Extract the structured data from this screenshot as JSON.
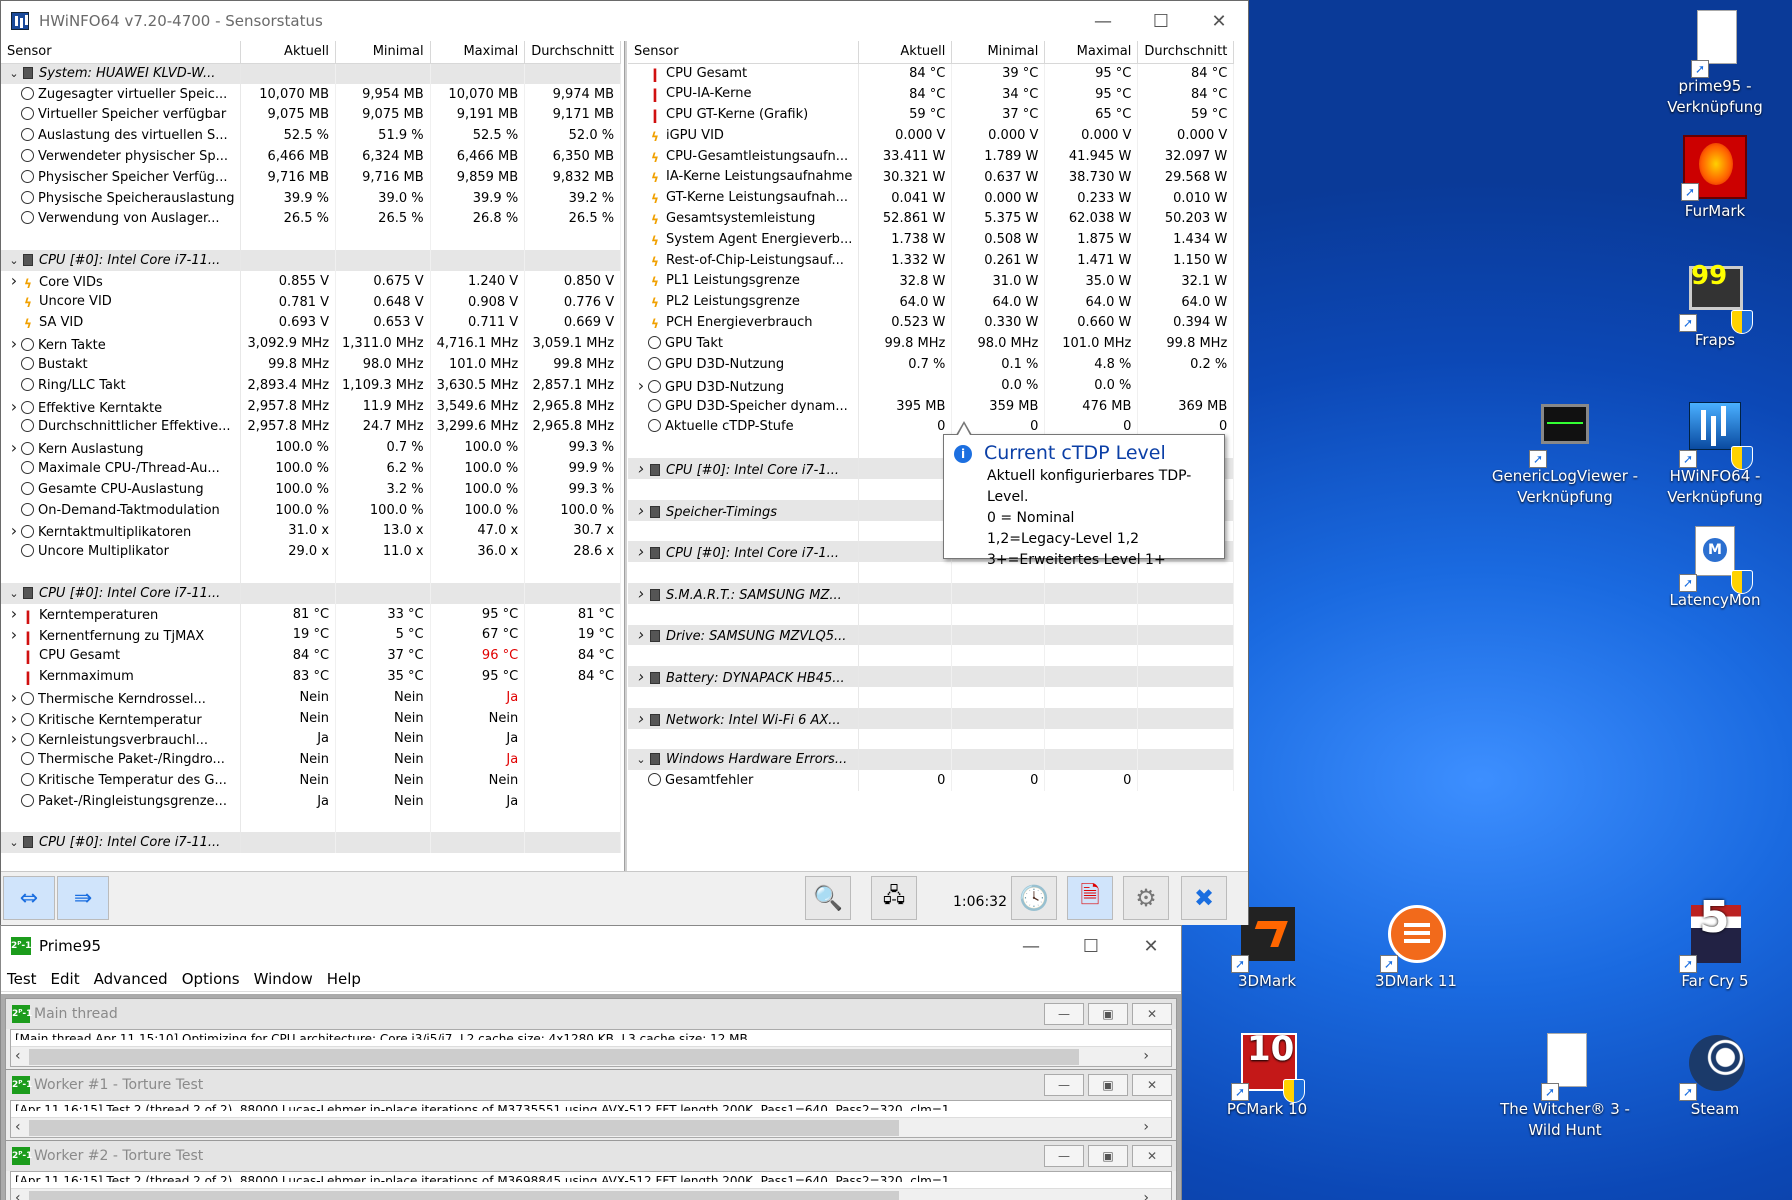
{
  "hwinfo": {
    "title": "HWiNFO64 v7.20-4700 - Sensorstatus",
    "left": {
      "headers": [
        "Sensor",
        "Aktuell",
        "Minimal",
        "Maximal",
        "Durchschnitt"
      ],
      "rows": [
        {
          "type": "group",
          "expand": "down",
          "label": "System: HUAWEI KLVD-W..."
        },
        {
          "type": "row",
          "icon": "clock",
          "label": "Zugesagter virtueller Speic...",
          "v": [
            "10,070 MB",
            "9,954 MB",
            "10,070 MB",
            "9,974 MB"
          ]
        },
        {
          "type": "row",
          "icon": "clock",
          "label": "Virtueller Speicher verfügbar",
          "v": [
            "9,075 MB",
            "9,075 MB",
            "9,191 MB",
            "9,171 MB"
          ]
        },
        {
          "type": "row",
          "icon": "clock",
          "label": "Auslastung des virtuellen S...",
          "v": [
            "52.5 %",
            "51.9 %",
            "52.5 %",
            "52.0 %"
          ]
        },
        {
          "type": "row",
          "icon": "clock",
          "label": "Verwendeter physischer Sp...",
          "v": [
            "6,466 MB",
            "6,324 MB",
            "6,466 MB",
            "6,350 MB"
          ]
        },
        {
          "type": "row",
          "icon": "clock",
          "label": "Physischer Speicher Verfüg...",
          "v": [
            "9,716 MB",
            "9,716 MB",
            "9,859 MB",
            "9,832 MB"
          ]
        },
        {
          "type": "row",
          "icon": "clock",
          "label": "Physische Speicherauslastung",
          "v": [
            "39.9 %",
            "39.0 %",
            "39.9 %",
            "39.2 %"
          ]
        },
        {
          "type": "row",
          "icon": "clock",
          "label": "Verwendung von Auslager...",
          "v": [
            "26.5 %",
            "26.5 %",
            "26.8 %",
            "26.5 %"
          ]
        },
        {
          "type": "blank"
        },
        {
          "type": "group",
          "expand": "down",
          "label": "CPU [#0]: Intel Core i7-11..."
        },
        {
          "type": "row",
          "expand": "right",
          "icon": "volt",
          "label": "Core VIDs",
          "v": [
            "0.855 V",
            "0.675 V",
            "1.240 V",
            "0.850 V"
          ]
        },
        {
          "type": "row",
          "icon": "volt",
          "label": "Uncore VID",
          "v": [
            "0.781 V",
            "0.648 V",
            "0.908 V",
            "0.776 V"
          ]
        },
        {
          "type": "row",
          "icon": "volt",
          "label": "SA VID",
          "v": [
            "0.693 V",
            "0.653 V",
            "0.711 V",
            "0.669 V"
          ]
        },
        {
          "type": "row",
          "expand": "right",
          "icon": "clock",
          "label": "Kern Takte",
          "v": [
            "3,092.9 MHz",
            "1,311.0 MHz",
            "4,716.1 MHz",
            "3,059.1 MHz"
          ]
        },
        {
          "type": "row",
          "icon": "clock",
          "label": "Bustakt",
          "v": [
            "99.8 MHz",
            "98.0 MHz",
            "101.0 MHz",
            "99.8 MHz"
          ]
        },
        {
          "type": "row",
          "icon": "clock",
          "label": "Ring/LLC Takt",
          "v": [
            "2,893.4 MHz",
            "1,109.3 MHz",
            "3,630.5 MHz",
            "2,857.1 MHz"
          ]
        },
        {
          "type": "row",
          "expand": "right",
          "icon": "clock",
          "label": "Effektive Kerntakte",
          "v": [
            "2,957.8 MHz",
            "11.9 MHz",
            "3,549.6 MHz",
            "2,965.8 MHz"
          ]
        },
        {
          "type": "row",
          "icon": "clock",
          "label": "Durchschnittlicher Effektive...",
          "v": [
            "2,957.8 MHz",
            "24.7 MHz",
            "3,299.6 MHz",
            "2,965.8 MHz"
          ]
        },
        {
          "type": "row",
          "expand": "right",
          "icon": "clock",
          "label": "Kern Auslastung",
          "v": [
            "100.0 %",
            "0.7 %",
            "100.0 %",
            "99.3 %"
          ]
        },
        {
          "type": "row",
          "icon": "clock",
          "label": "Maximale CPU-/Thread-Au...",
          "v": [
            "100.0 %",
            "6.2 %",
            "100.0 %",
            "99.9 %"
          ]
        },
        {
          "type": "row",
          "icon": "clock",
          "label": "Gesamte CPU-Auslastung",
          "v": [
            "100.0 %",
            "3.2 %",
            "100.0 %",
            "99.3 %"
          ]
        },
        {
          "type": "row",
          "icon": "clock",
          "label": "On-Demand-Taktmodulation",
          "v": [
            "100.0 %",
            "100.0 %",
            "100.0 %",
            "100.0 %"
          ]
        },
        {
          "type": "row",
          "expand": "right",
          "icon": "clock",
          "label": "Kerntaktmultiplikatoren",
          "v": [
            "31.0 x",
            "13.0 x",
            "47.0 x",
            "30.7 x"
          ]
        },
        {
          "type": "row",
          "icon": "clock",
          "label": "Uncore Multiplikator",
          "v": [
            "29.0 x",
            "11.0 x",
            "36.0 x",
            "28.6 x"
          ]
        },
        {
          "type": "blank"
        },
        {
          "type": "group",
          "expand": "down",
          "label": "CPU [#0]: Intel Core i7-11..."
        },
        {
          "type": "row",
          "expand": "right",
          "icon": "therm",
          "label": "Kerntemperaturen",
          "v": [
            "81 °C",
            "33 °C",
            "95 °C",
            "81 °C"
          ]
        },
        {
          "type": "row",
          "expand": "right",
          "icon": "therm",
          "label": "Kernentfernung zu TjMAX",
          "v": [
            "19 °C",
            "5 °C",
            "67 °C",
            "19 °C"
          ]
        },
        {
          "type": "row",
          "icon": "therm",
          "label": "CPU Gesamt",
          "v": [
            "84 °C",
            "37 °C",
            "96 °C",
            "84 °C"
          ],
          "red": [
            2
          ]
        },
        {
          "type": "row",
          "icon": "therm",
          "label": "Kernmaximum",
          "v": [
            "83 °C",
            "35 °C",
            "95 °C",
            "84 °C"
          ]
        },
        {
          "type": "row",
          "expand": "right",
          "icon": "clock",
          "label": "Thermische Kerndrossel...",
          "v": [
            "Nein",
            "Nein",
            "Ja",
            ""
          ],
          "red": [
            2
          ]
        },
        {
          "type": "row",
          "expand": "right",
          "icon": "clock",
          "label": "Kritische Kerntemperatur",
          "v": [
            "Nein",
            "Nein",
            "Nein",
            ""
          ]
        },
        {
          "type": "row",
          "expand": "right",
          "icon": "clock",
          "label": "Kernleistungsverbrauchl...",
          "v": [
            "Ja",
            "Nein",
            "Ja",
            ""
          ]
        },
        {
          "type": "row",
          "icon": "clock",
          "label": "Thermische Paket-/Ringdro...",
          "v": [
            "Nein",
            "Nein",
            "Ja",
            ""
          ],
          "red": [
            2
          ]
        },
        {
          "type": "row",
          "icon": "clock",
          "label": "Kritische Temperatur des G...",
          "v": [
            "Nein",
            "Nein",
            "Nein",
            ""
          ]
        },
        {
          "type": "row",
          "icon": "clock",
          "label": "Paket-/Ringleistungsgrenze...",
          "v": [
            "Ja",
            "Nein",
            "Ja",
            ""
          ]
        },
        {
          "type": "blank"
        },
        {
          "type": "group",
          "expand": "down",
          "label": "CPU [#0]: Intel Core i7-11..."
        }
      ]
    },
    "right": {
      "headers": [
        "Sensor",
        "Aktuell",
        "Minimal",
        "Maximal",
        "Durchschnitt"
      ],
      "rows": [
        {
          "type": "row",
          "icon": "therm",
          "label": "CPU Gesamt",
          "v": [
            "84 °C",
            "39 °C",
            "95 °C",
            "84 °C"
          ]
        },
        {
          "type": "row",
          "icon": "therm",
          "label": "CPU-IA-Kerne",
          "v": [
            "84 °C",
            "34 °C",
            "95 °C",
            "84 °C"
          ]
        },
        {
          "type": "row",
          "icon": "therm",
          "label": "CPU GT-Kerne (Grafik)",
          "v": [
            "59 °C",
            "37 °C",
            "65 °C",
            "59 °C"
          ]
        },
        {
          "type": "row",
          "icon": "volt",
          "label": "iGPU VID",
          "v": [
            "0.000 V",
            "0.000 V",
            "0.000 V",
            "0.000 V"
          ]
        },
        {
          "type": "row",
          "icon": "volt",
          "label": "CPU-Gesamtleistungsaufn...",
          "v": [
            "33.411 W",
            "1.789 W",
            "41.945 W",
            "32.097 W"
          ]
        },
        {
          "type": "row",
          "icon": "volt",
          "label": "IA-Kerne Leistungsaufnahme",
          "v": [
            "30.321 W",
            "0.637 W",
            "38.730 W",
            "29.568 W"
          ]
        },
        {
          "type": "row",
          "icon": "volt",
          "label": "GT-Kerne Leistungsaufnah...",
          "v": [
            "0.041 W",
            "0.000 W",
            "0.233 W",
            "0.010 W"
          ]
        },
        {
          "type": "row",
          "icon": "volt",
          "label": "Gesamtsystemleistung",
          "v": [
            "52.861 W",
            "5.375 W",
            "62.038 W",
            "50.203 W"
          ]
        },
        {
          "type": "row",
          "icon": "volt",
          "label": "System Agent Energieverb...",
          "v": [
            "1.738 W",
            "0.508 W",
            "1.875 W",
            "1.434 W"
          ]
        },
        {
          "type": "row",
          "icon": "volt",
          "label": "Rest-of-Chip-Leistungsauf...",
          "v": [
            "1.332 W",
            "0.261 W",
            "1.471 W",
            "1.150 W"
          ]
        },
        {
          "type": "row",
          "icon": "volt",
          "label": "PL1 Leistungsgrenze",
          "v": [
            "32.8 W",
            "31.0 W",
            "35.0 W",
            "32.1 W"
          ]
        },
        {
          "type": "row",
          "icon": "volt",
          "label": "PL2 Leistungsgrenze",
          "v": [
            "64.0 W",
            "64.0 W",
            "64.0 W",
            "64.0 W"
          ]
        },
        {
          "type": "row",
          "icon": "volt",
          "label": "PCH Energieverbrauch",
          "v": [
            "0.523 W",
            "0.330 W",
            "0.660 W",
            "0.394 W"
          ]
        },
        {
          "type": "row",
          "icon": "clock",
          "label": "GPU Takt",
          "v": [
            "99.8 MHz",
            "98.0 MHz",
            "101.0 MHz",
            "99.8 MHz"
          ]
        },
        {
          "type": "row",
          "icon": "clock",
          "label": "GPU D3D-Nutzung",
          "v": [
            "0.7 %",
            "0.1 %",
            "4.8 %",
            "0.2 %"
          ]
        },
        {
          "type": "row",
          "expand": "right",
          "icon": "clock",
          "label": "GPU D3D-Nutzung",
          "v": [
            "",
            "0.0 %",
            "0.0 %",
            ""
          ]
        },
        {
          "type": "row",
          "icon": "clock",
          "label": "GPU D3D-Speicher dynam...",
          "v": [
            "395 MB",
            "359 MB",
            "476 MB",
            "369 MB"
          ]
        },
        {
          "type": "row",
          "icon": "clock",
          "label": "Aktuelle cTDP-Stufe",
          "v": [
            "0",
            "0",
            "0",
            "0"
          ]
        },
        {
          "type": "blank"
        },
        {
          "type": "group",
          "expand": "right",
          "label": "CPU [#0]: Intel Core i7-1..."
        },
        {
          "type": "blank"
        },
        {
          "type": "group",
          "expand": "right",
          "label": "Speicher-Timings"
        },
        {
          "type": "blank"
        },
        {
          "type": "group",
          "expand": "right",
          "label": "CPU [#0]: Intel Core i7-1..."
        },
        {
          "type": "blank"
        },
        {
          "type": "group",
          "expand": "right",
          "label": "S.M.A.R.T.: SAMSUNG MZ..."
        },
        {
          "type": "blank"
        },
        {
          "type": "group",
          "expand": "right",
          "label": "Drive: SAMSUNG MZVLQ5..."
        },
        {
          "type": "blank"
        },
        {
          "type": "group",
          "expand": "right",
          "label": "Battery: DYNAPACK HB45..."
        },
        {
          "type": "blank"
        },
        {
          "type": "group",
          "expand": "right",
          "label": "Network: Intel Wi-Fi 6 AX..."
        },
        {
          "type": "blank"
        },
        {
          "type": "group",
          "expand": "down",
          "label": "Windows Hardware Errors..."
        },
        {
          "type": "row",
          "icon": "clock",
          "label": "Gesamtfehler",
          "v": [
            "0",
            "0",
            "0",
            ""
          ]
        }
      ]
    },
    "tooltip": {
      "title": "Current cTDP Level",
      "lines": [
        "Aktuell konfigurierbares TDP-Level.",
        "0 = Nominal",
        "1,2=Legacy-Level 1,2",
        "3+=Erweitertes Level 1+"
      ]
    },
    "timer": "1:06:32"
  },
  "prime95": {
    "title": "Prime95",
    "menu": [
      "Test",
      "Edit",
      "Advanced",
      "Options",
      "Window",
      "Help"
    ],
    "children": [
      {
        "title": "Main thread",
        "log": "[Main thread Apr 11 15:10] Optimizing for CPU architecture: Core i3/i5/i7, L2 cache size: 4x1280 KB, L3 cache size: 12 MB"
      },
      {
        "title": "Worker #1 - Torture Test",
        "log": "[Apr 11 16:15] Test 2 (thread 2 of 2), 88000 Lucas-Lehmer in-place iterations of M3735551 using AVX-512 FFT length 200K, Pass1=640, Pass2=320, clm=1."
      },
      {
        "title": "Worker #2 - Torture Test",
        "log": "[Apr 11 16:15] Test 2 (thread 2 of 2), 88000 Lucas-Lehmer in-place iterations of M3698845 using AVX-512 FFT length 200K, Pass1=640, Pass2=320, clm=1."
      }
    ]
  },
  "desktop_icons": [
    {
      "label": "prime95 - Verknüpfung",
      "icon": "file-icon"
    },
    {
      "label": "FurMark",
      "icon": "furmark-icon"
    },
    {
      "label": "Fraps",
      "icon": "fraps-icon"
    },
    {
      "label": "GenericLogViewer - Verknüpfung",
      "icon": "monitor-icon"
    },
    {
      "label": "HWiNFO64 - Verknüpfung",
      "icon": "hwinfo-icon"
    },
    {
      "label": "LatencyMon",
      "icon": "latencymon-icon"
    },
    {
      "label": "3DMark",
      "icon": "3dmark-icon"
    },
    {
      "label": "3DMark 11",
      "icon": "3dmark11-icon"
    },
    {
      "label": "Far Cry 5",
      "icon": "farcry5-icon"
    },
    {
      "label": "PCMark 10",
      "icon": "pcmark-icon"
    },
    {
      "label": "The Witcher® 3 - Wild Hunt",
      "icon": "file-icon"
    },
    {
      "label": "Steam",
      "icon": "steam-icon"
    }
  ],
  "colors": {
    "desktop": "#1a6ae0",
    "alert": "#e00000",
    "tooltip_title": "#0b3fa6"
  }
}
